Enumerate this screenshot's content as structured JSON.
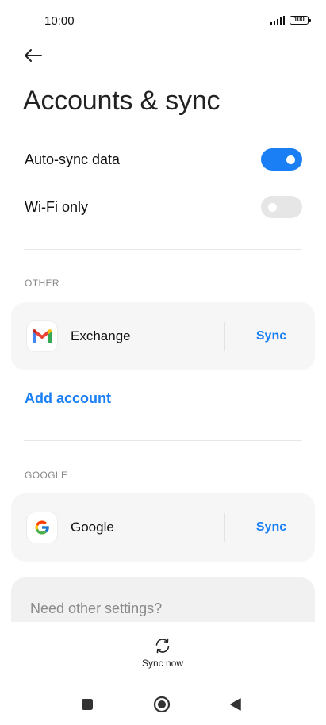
{
  "status_bar": {
    "time": "10:00",
    "battery": "100"
  },
  "title": "Accounts & sync",
  "settings": {
    "auto_sync": {
      "label": "Auto-sync data",
      "enabled": true
    },
    "wifi_only": {
      "label": "Wi-Fi only",
      "enabled": false
    }
  },
  "sections": {
    "other": {
      "header": "OTHER",
      "account": {
        "name": "Exchange",
        "action": "Sync",
        "icon": "gmail-icon"
      },
      "add_account": "Add account"
    },
    "google": {
      "header": "GOOGLE",
      "account": {
        "name": "Google",
        "action": "Sync",
        "icon": "google-icon"
      }
    }
  },
  "other_settings": "Need other settings?",
  "bottom_action": {
    "label": "Sync now",
    "icon": "sync-icon"
  },
  "colors": {
    "accent": "#1a7ff5",
    "toggle_off": "#e6e6e6",
    "card_bg": "#f6f6f6"
  }
}
